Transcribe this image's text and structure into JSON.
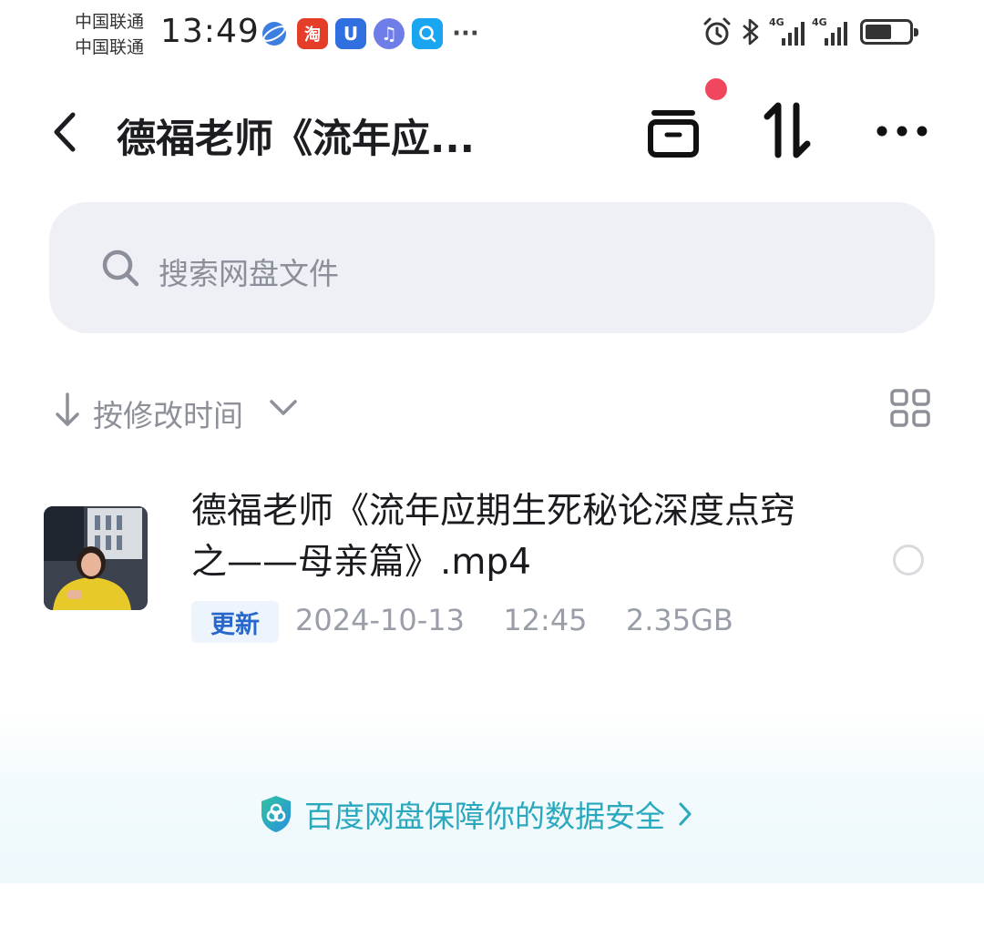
{
  "status_bar": {
    "carrier_1": "中国联通",
    "carrier_2": "中国联通",
    "time": "13:49",
    "notification_icons": [
      "browser-globe-icon",
      "taobao-icon",
      "u-app-icon",
      "music-icon",
      "search-app-icon",
      "more-notifications-icon"
    ],
    "taobao_glyph": "淘",
    "u_glyph": "U",
    "music_glyph": "♫",
    "more_glyph": "···",
    "signal_tag_1": "4G",
    "signal_tag_2": "4G",
    "system_icons": [
      "alarm-icon",
      "bluetooth-icon",
      "signal-icon",
      "signal-icon",
      "battery-icon"
    ],
    "battery_level": 0.6
  },
  "header": {
    "title": "德福老师《流年应...",
    "has_notification_dot": true,
    "colors": {
      "notification_dot": "#f0475e"
    }
  },
  "search": {
    "placeholder": "搜索网盘文件"
  },
  "sort": {
    "label": "按修改时间"
  },
  "files": [
    {
      "name": "德福老师《流年应期生死秘论深度点窍之——母亲篇》.mp4",
      "badge": "更新",
      "date": "2024-10-13",
      "time": "12:45",
      "size": "2.35GB"
    }
  ],
  "footer": {
    "safety_text": "百度网盘保障你的数据安全",
    "colors": {
      "accent": "#2aa8bd"
    }
  }
}
